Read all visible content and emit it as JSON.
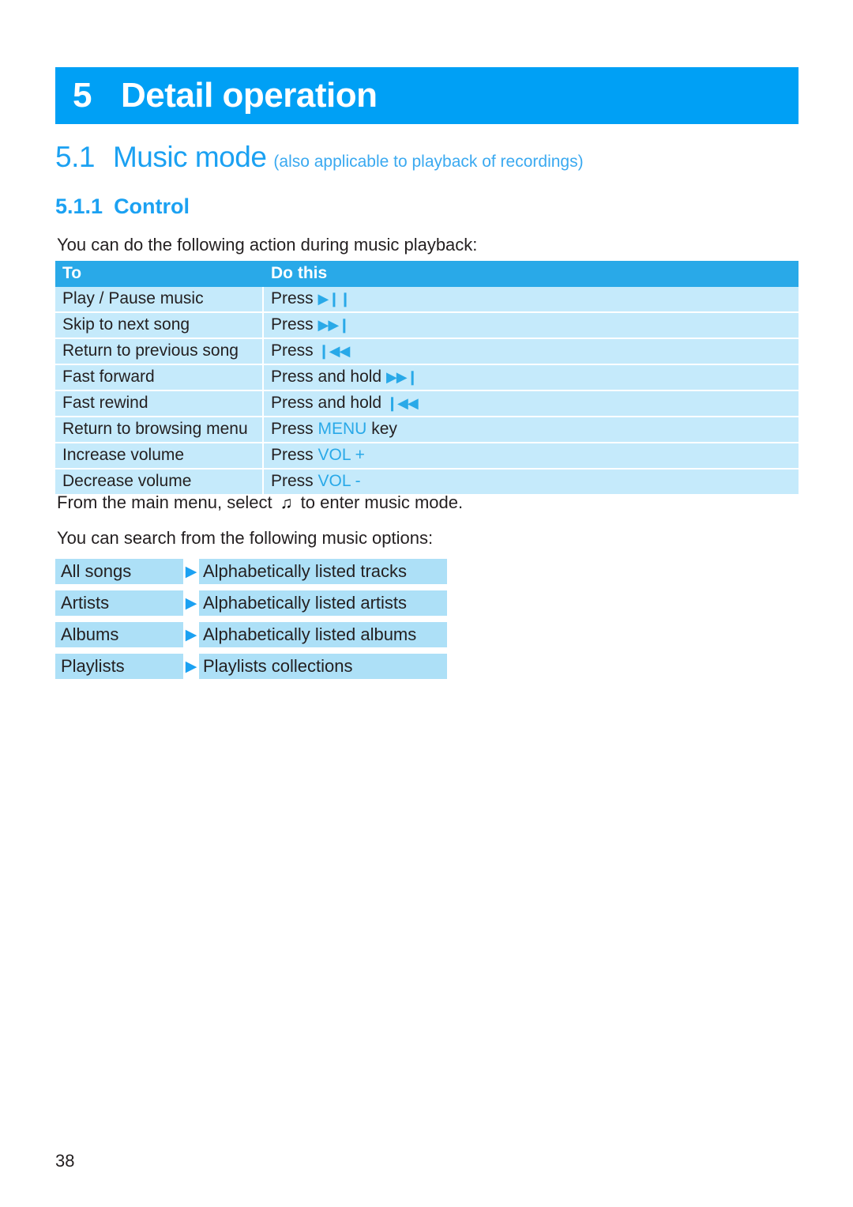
{
  "chapter": {
    "number": "5",
    "title": "Detail operation"
  },
  "section": {
    "number": "5.1",
    "name": "Music mode",
    "note": "(also applicable to playback of recordings)"
  },
  "subsection": {
    "number": "5.1.1",
    "name": "Control"
  },
  "paragraphs": {
    "intro": "You can do the following action during music playback:",
    "main_menu_before": "From the main menu, select",
    "main_menu_glyph": "♫",
    "main_menu_after": "to enter music mode.",
    "search_options": "You can search from the following music options:"
  },
  "control_table": {
    "headers": {
      "to": "To",
      "do_this": "Do this"
    },
    "rows": [
      {
        "to": "Play / Pause music",
        "action_prefix": "Press",
        "icon": "▶❙❙",
        "icon_name": "play-pause-icon",
        "accent": "",
        "suffix": ""
      },
      {
        "to": "Skip to next song",
        "action_prefix": "Press",
        "icon": "▶▶❙",
        "icon_name": "next-track-icon",
        "accent": "",
        "suffix": ""
      },
      {
        "to": "Return to previous song",
        "action_prefix": "Press",
        "icon": "❙◀◀",
        "icon_name": "previous-track-icon",
        "accent": "",
        "suffix": ""
      },
      {
        "to": "Fast forward",
        "action_prefix": "Press and hold",
        "icon": "▶▶❙",
        "icon_name": "fast-forward-icon",
        "accent": "",
        "suffix": ""
      },
      {
        "to": "Fast rewind",
        "action_prefix": "Press and hold",
        "icon": "❙◀◀",
        "icon_name": "fast-rewind-icon",
        "accent": "",
        "suffix": ""
      },
      {
        "to": "Return to browsing menu",
        "action_prefix": "Press",
        "icon": "",
        "icon_name": "",
        "accent": "MENU",
        "suffix": "key"
      },
      {
        "to": "Increase volume",
        "action_prefix": "Press",
        "icon": "",
        "icon_name": "",
        "accent": "VOL +",
        "suffix": ""
      },
      {
        "to": "Decrease volume",
        "action_prefix": "Press",
        "icon": "",
        "icon_name": "",
        "accent": "VOL -",
        "suffix": ""
      }
    ]
  },
  "music_options": {
    "arrow_glyph": "▶",
    "rows": [
      {
        "option": "All songs",
        "description": "Alphabetically listed tracks"
      },
      {
        "option": "Artists",
        "description": "Alphabetically listed artists"
      },
      {
        "option": "Albums",
        "description": "Alphabetically listed albums"
      },
      {
        "option": "Playlists",
        "description": "Playlists collections"
      }
    ]
  },
  "footer": {
    "page_number": "38"
  },
  "colors": {
    "banner_blue": "#00a0f5",
    "heading_blue": "#1ba1f2",
    "table_header_blue": "#29a9e8",
    "table_row_blue": "#c5eafb",
    "option_box_blue": "#ade0f7",
    "body_text": "#231f20"
  }
}
